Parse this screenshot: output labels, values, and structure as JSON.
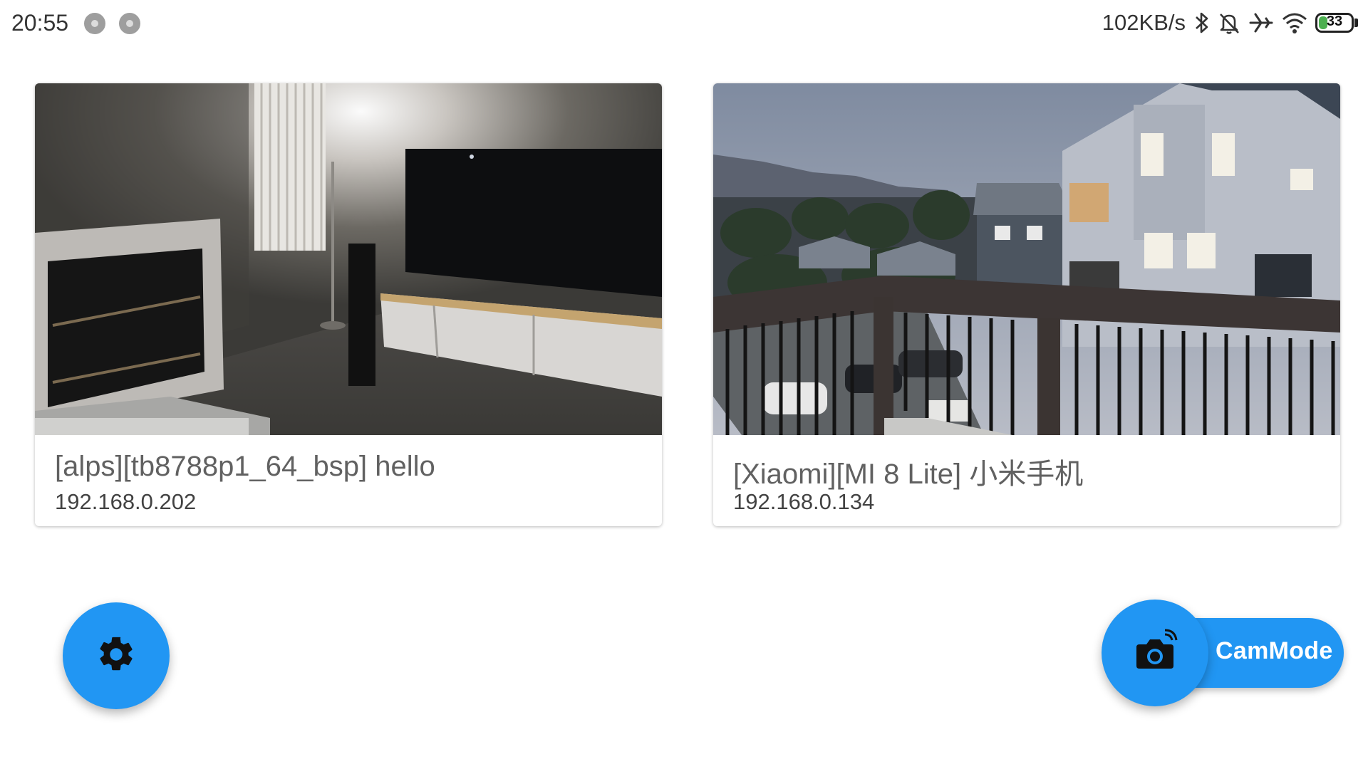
{
  "status_bar": {
    "time": "20:55",
    "notification_icons": [
      "circle-notification-icon",
      "circle-notification-icon"
    ],
    "network_speed": "102KB/s",
    "icons": [
      "bluetooth-icon",
      "bell-off-icon",
      "airplane-icon",
      "wifi-icon"
    ],
    "battery_level": "33",
    "battery_percent": 33
  },
  "devices": [
    {
      "name": "[alps][tb8788p1_64_bsp] hello",
      "ip": "192.168.0.202",
      "preview": "living-room-camera-preview"
    },
    {
      "name": "[Xiaomi][MI 8 Lite] 小米手机",
      "ip": "192.168.0.134",
      "preview": "balcony-camera-preview"
    }
  ],
  "fab_settings": {
    "icon": "gear-icon"
  },
  "fab_cam_mode": {
    "icon": "camera-switch-icon",
    "label": "CamMode"
  },
  "colors": {
    "accent": "#2196f3",
    "battery": "#4caf50"
  }
}
